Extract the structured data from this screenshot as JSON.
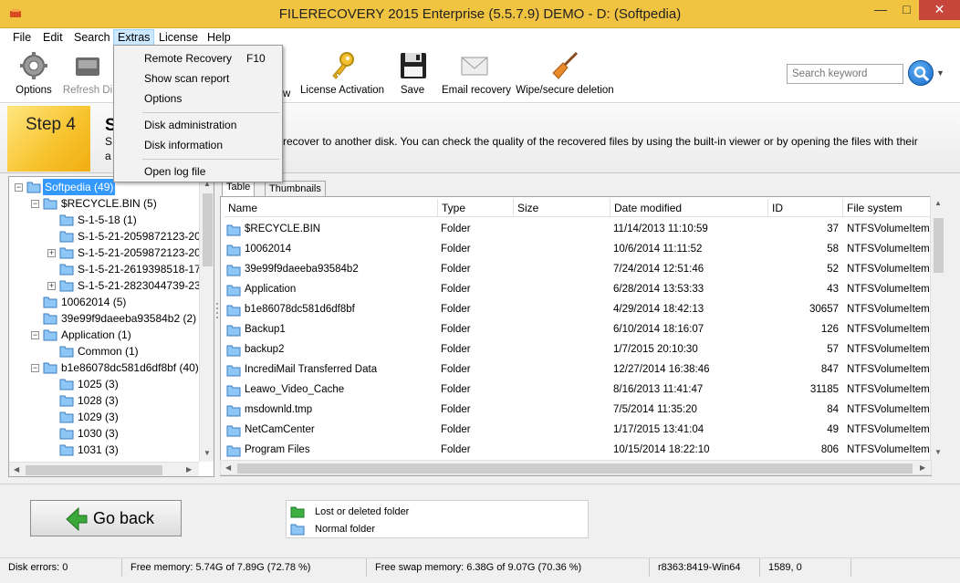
{
  "window": {
    "title": "FILERECOVERY 2015 Enterprise (5.5.7.9) DEMO - D: (Softpedia)"
  },
  "menubar": {
    "items": [
      "File",
      "Edit",
      "Search",
      "Extras",
      "License",
      "Help"
    ]
  },
  "toolbar": {
    "options_label": "Options",
    "refresh_label": "Refresh Di",
    "show_label": "ow",
    "license_label": "License Activation",
    "save_label": "Save",
    "email_label": "Email recovery",
    "wipe_label": "Wipe/secure deletion",
    "search_placeholder": "Search keyword"
  },
  "extras_menu": {
    "items": [
      {
        "label": "Remote Recovery",
        "shortcut": "F10"
      },
      {
        "label": "Show scan report"
      },
      {
        "label": "Options"
      },
      {
        "label": "Disk administration"
      },
      {
        "label": "Disk information"
      },
      {
        "label": "Open log file"
      }
    ]
  },
  "step": {
    "label": "Step 4",
    "title_fragment": "S",
    "line1_lead": "S",
    "line1": "recover to another disk. You can check the quality of the recovered files by using the built-in viewer or by opening the files with their",
    "line2_lead": "a"
  },
  "tree": {
    "items": [
      {
        "label": "Softpedia (49)",
        "selected": true
      },
      {
        "label": "$RECYCLE.BIN (5)"
      },
      {
        "label": "S-1-5-18 (1)"
      },
      {
        "label": "S-1-5-21-2059872123-20"
      },
      {
        "label": "S-1-5-21-2059872123-20"
      },
      {
        "label": "S-1-5-21-2619398518-17"
      },
      {
        "label": "S-1-5-21-2823044739-23"
      },
      {
        "label": "10062014 (5)"
      },
      {
        "label": "39e99f9daeeba93584b2 (2)"
      },
      {
        "label": "Application (1)"
      },
      {
        "label": "Common (1)"
      },
      {
        "label": "b1e86078dc581d6df8bf (40)"
      },
      {
        "label": "1025 (3)"
      },
      {
        "label": "1028 (3)"
      },
      {
        "label": "1029 (3)"
      },
      {
        "label": "1030 (3)"
      },
      {
        "label": "1031 (3)"
      }
    ]
  },
  "tabs": [
    "Table",
    "Thumbnails"
  ],
  "table": {
    "columns": [
      "Name",
      "Type",
      "Size",
      "Date modified",
      "ID",
      "File system"
    ],
    "rows": [
      {
        "name": "$RECYCLE.BIN",
        "type": "Folder",
        "size": "",
        "date": "11/14/2013 11:10:59",
        "id": "37",
        "fs": "NTFSVolumeItem"
      },
      {
        "name": "10062014",
        "type": "Folder",
        "size": "",
        "date": "10/6/2014 11:11:52",
        "id": "58",
        "fs": "NTFSVolumeItem"
      },
      {
        "name": "39e99f9daeeba93584b2",
        "type": "Folder",
        "size": "",
        "date": "7/24/2014 12:51:46",
        "id": "52",
        "fs": "NTFSVolumeItem"
      },
      {
        "name": "Application",
        "type": "Folder",
        "size": "",
        "date": "6/28/2014 13:53:33",
        "id": "43",
        "fs": "NTFSVolumeItem"
      },
      {
        "name": "b1e86078dc581d6df8bf",
        "type": "Folder",
        "size": "",
        "date": "4/29/2014 18:42:13",
        "id": "30657",
        "fs": "NTFSVolumeItem"
      },
      {
        "name": "Backup1",
        "type": "Folder",
        "size": "",
        "date": "6/10/2014 18:16:07",
        "id": "126",
        "fs": "NTFSVolumeItem"
      },
      {
        "name": "backup2",
        "type": "Folder",
        "size": "",
        "date": "1/7/2015 20:10:30",
        "id": "57",
        "fs": "NTFSVolumeItem"
      },
      {
        "name": "IncrediMail Transferred Data",
        "type": "Folder",
        "size": "",
        "date": "12/27/2014 16:38:46",
        "id": "847",
        "fs": "NTFSVolumeItem"
      },
      {
        "name": "Leawo_Video_Cache",
        "type": "Folder",
        "size": "",
        "date": "8/16/2013 11:41:47",
        "id": "31185",
        "fs": "NTFSVolumeItem"
      },
      {
        "name": "msdownld.tmp",
        "type": "Folder",
        "size": "",
        "date": "7/5/2014 11:35:20",
        "id": "84",
        "fs": "NTFSVolumeItem"
      },
      {
        "name": "NetCamCenter",
        "type": "Folder",
        "size": "",
        "date": "1/17/2015 13:41:04",
        "id": "49",
        "fs": "NTFSVolumeItem"
      },
      {
        "name": "Program Files",
        "type": "Folder",
        "size": "",
        "date": "10/15/2014 18:22:10",
        "id": "806",
        "fs": "NTFSVolumeItem"
      }
    ]
  },
  "bottom": {
    "go_back_label": "Go back",
    "legend_deleted": "Lost or deleted folder",
    "legend_normal": "Normal folder"
  },
  "status": {
    "disk_errors": "Disk errors: 0",
    "free_memory": "Free memory: 5.74G of 7.89G (72.78 %)",
    "free_swap": "Free swap memory: 6.38G of 9.07G (70.36 %)",
    "build": "r8363:8419-Win64",
    "coords": "1589, 0"
  },
  "colors": {
    "titlebar": "#f0c341",
    "step_box": "#f7c22b",
    "selection": "#3399ff",
    "close_button": "#c7463b",
    "deleted_folder": "#3cb043",
    "normal_folder": "#8ec6f5"
  }
}
